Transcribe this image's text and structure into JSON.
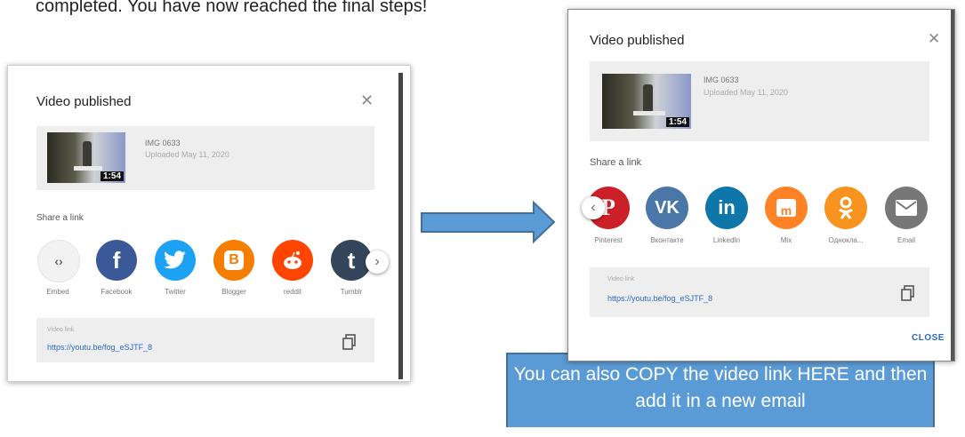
{
  "intro_text": "completed. You have now reached the final steps!",
  "left_dialog": {
    "title": "Video published",
    "video_name": "IMG 0633",
    "uploaded": "Uploaded May 11, 2020",
    "duration": "1:54",
    "share_label": "Share a link",
    "share_items": [
      {
        "label": "Embed",
        "icon": "embed-icon",
        "glyph": "<>",
        "color": "#f2f2f2"
      },
      {
        "label": "Facebook",
        "icon": "facebook-icon",
        "glyph": "f",
        "color": "#3b5998"
      },
      {
        "label": "Twitter",
        "icon": "twitter-icon",
        "glyph": "t",
        "color": "#1da1f2"
      },
      {
        "label": "Blogger",
        "icon": "blogger-icon",
        "glyph": "B",
        "color": "#f57d00"
      },
      {
        "label": "reddit",
        "icon": "reddit-icon",
        "glyph": "r",
        "color": "#ff4500"
      },
      {
        "label": "Tumblr",
        "icon": "tumblr-icon",
        "glyph": "t",
        "color": "#35465c"
      }
    ],
    "link_caption": "Video link",
    "link_url": "https://youtu.be/fog_eSJTF_8"
  },
  "right_dialog": {
    "title": "Video published",
    "video_name": "IMG 0633",
    "uploaded": "Uploaded May 11, 2020",
    "duration": "1:54",
    "share_label": "Share a link",
    "share_items": [
      {
        "label": "Pinterest",
        "icon": "pinterest-icon",
        "glyph": "P",
        "color": "#cb2027"
      },
      {
        "label": "Вконтакте",
        "icon": "vk-icon",
        "glyph": "VK",
        "color": "#4a76a8"
      },
      {
        "label": "LinkedIn",
        "icon": "linkedin-icon",
        "glyph": "in",
        "color": "#0e76a8"
      },
      {
        "label": "Mix",
        "icon": "mix-icon",
        "glyph": "m",
        "color": "#ff8226"
      },
      {
        "label": "Однокла...",
        "icon": "odnoklassniki-icon",
        "glyph": "ok",
        "color": "#f7931e"
      },
      {
        "label": "Email",
        "icon": "email-icon",
        "glyph": "✉",
        "color": "#777777"
      }
    ],
    "link_caption": "Video link",
    "link_url": "https://youtu.be/fog_eSJTF_8",
    "close_label": "CLOSE"
  },
  "callout": {
    "text": "You can also COPY the video link HERE and then add it in a new email"
  },
  "colors": {
    "callout_fill": "#5b9bd5",
    "callout_stroke": "#41719c",
    "link": "#2a6ac8"
  }
}
